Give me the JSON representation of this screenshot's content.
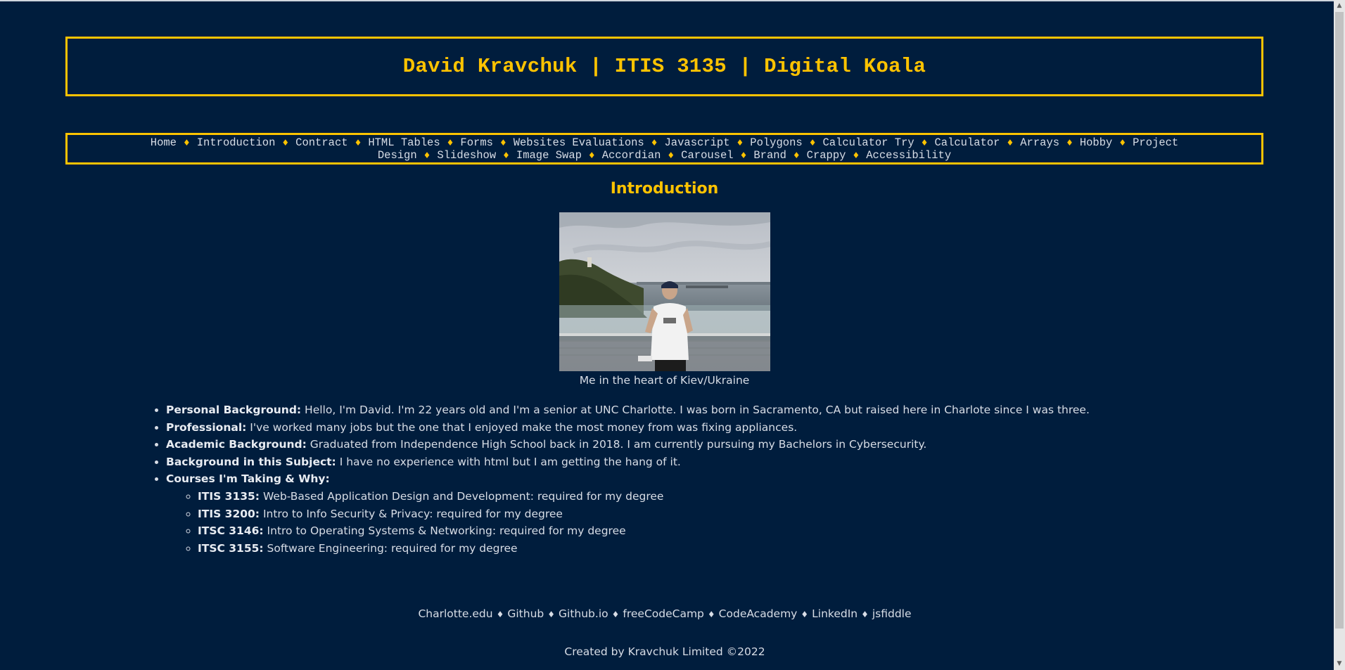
{
  "header": {
    "title": "David Kravchuk | ITIS 3135 | Digital Koala"
  },
  "nav": {
    "separator": "♦",
    "items": [
      "Home",
      "Introduction",
      "Contract",
      "HTML Tables",
      "Forms",
      "Websites Evaluations",
      "Javascript",
      "Polygons",
      "Calculator Try",
      "Calculator",
      "Arrays",
      "Hobby",
      "Project Design",
      "Slideshow",
      "Image Swap",
      "Accordian",
      "Carousel",
      "Brand",
      "Crappy",
      "Accessibility"
    ]
  },
  "main": {
    "heading": "Introduction",
    "caption": "Me in the heart of Kiev/Ukraine",
    "items": [
      {
        "label": "Personal Background:",
        "text": " Hello, I'm David. I'm 22 years old and I'm a senior at UNC Charlotte. I was born in Sacramento, CA but raised here in Charlote since I was three."
      },
      {
        "label": "Professional:",
        "text": " I've worked many jobs but the one that I enjoyed make the most money from was fixing appliances."
      },
      {
        "label": "Academic Background:",
        "text": " Graduated from Independence High School back in 2018. I am currently pursuing my Bachelors in Cybersecurity."
      },
      {
        "label": "Background in this Subject:",
        "text": " I have no experience with html but I am getting the hang of it."
      },
      {
        "label": "Courses I'm Taking & Why:",
        "text": ""
      }
    ],
    "courses": [
      {
        "code": "ITIS 3135:",
        "text": " Web-Based Application Design and Development: required for my degree"
      },
      {
        "code": "ITIS 3200:",
        "text": " Intro to Info Security & Privacy: required for my degree"
      },
      {
        "code": "ITSC 3146:",
        "text": " Intro to Operating Systems & Networking: required for my degree"
      },
      {
        "code": "ITSC 3155:",
        "text": " Software Engineering: required for my degree"
      }
    ]
  },
  "footer": {
    "links": [
      "Charlotte.edu",
      "Github",
      "Github.io",
      "freeCodeCamp",
      "CodeAcademy",
      "LinkedIn",
      "jsfiddle"
    ],
    "separator": "♦",
    "copyright": "Created by Kravchuk Limited ©2022"
  },
  "colors": {
    "background": "#001d3d",
    "accent": "#ffc300",
    "text": "#d8dde6"
  },
  "icons": {
    "scroll_up": "scroll-up-arrow-icon",
    "scroll_down": "scroll-down-arrow-icon",
    "separator": "diamond-icon"
  }
}
